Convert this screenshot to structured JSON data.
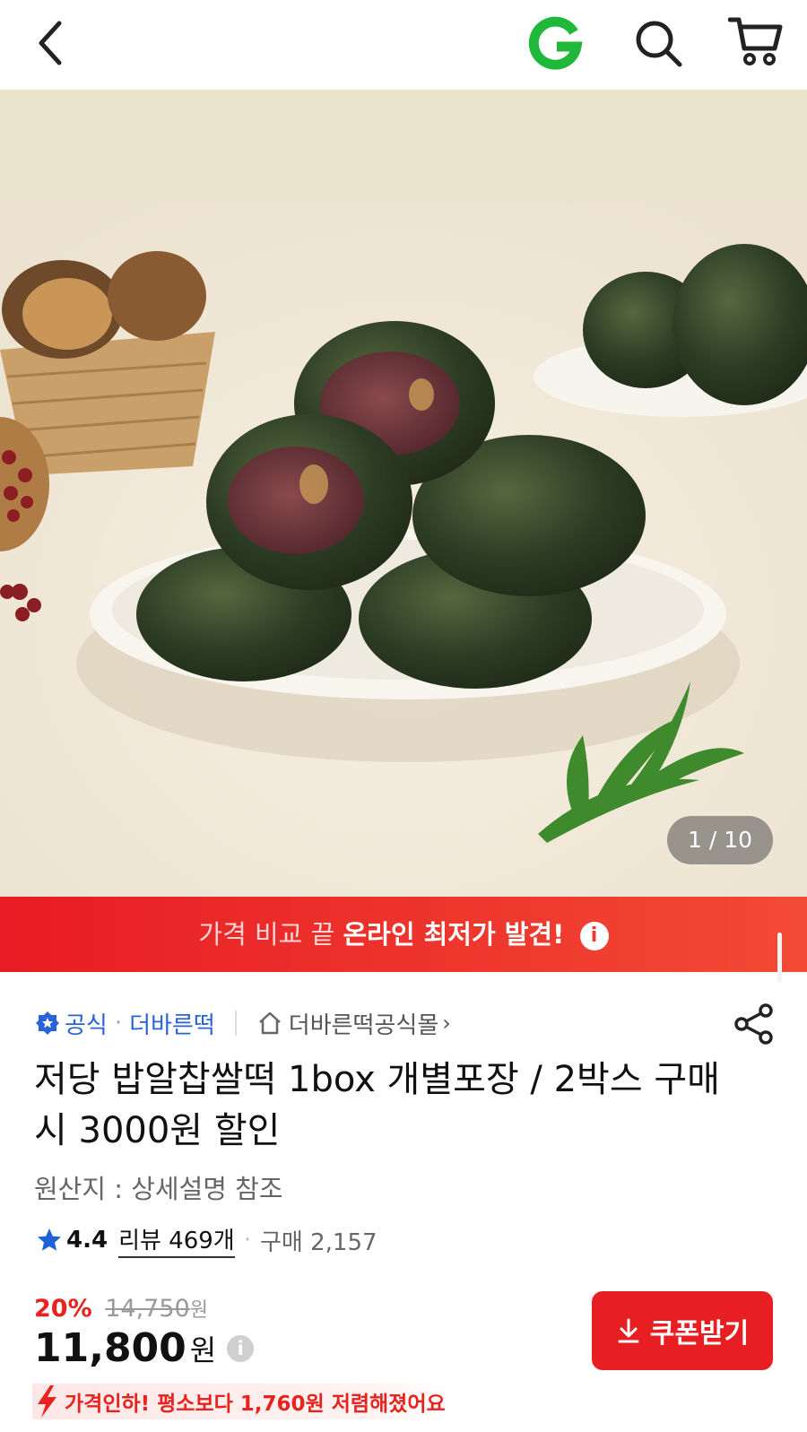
{
  "header": {
    "back_icon": "chevron-left-icon",
    "logo_icon": "g-logo-icon",
    "search_icon": "search-icon",
    "cart_icon": "cart-icon"
  },
  "gallery": {
    "counter": "1 / 10"
  },
  "promo": {
    "normal_text": "가격 비교 끝",
    "bold_text": "온라인 최저가 발견!",
    "info_glyph": "i"
  },
  "seller": {
    "badge_label": "공식",
    "brand": "더바른떡",
    "shop_name": "더바른떡공식몰",
    "shop_chevron": "›"
  },
  "product": {
    "title": "저당 밥알찹쌀떡 1box 개별포장 / 2박스 구매 시 3000원 할인",
    "origin": "원산지 : 상세설명 참조",
    "rating": "4.4",
    "reviews": "리뷰 469개",
    "sales": "구매 2,157"
  },
  "pricing": {
    "discount_percent": "20%",
    "original_price": "14,750",
    "original_unit": "원",
    "sale_price": "11,800",
    "sale_unit": "원",
    "info_glyph": "i",
    "coupon_label": "쿠폰받기",
    "price_drop_text": "가격인하! 평소보다 1,760원 저렴해졌어요"
  },
  "colors": {
    "accent_red": "#e81f22",
    "official_blue": "#2a63d8",
    "logo_green": "#1fb83a",
    "star_blue": "#1e63d6"
  }
}
